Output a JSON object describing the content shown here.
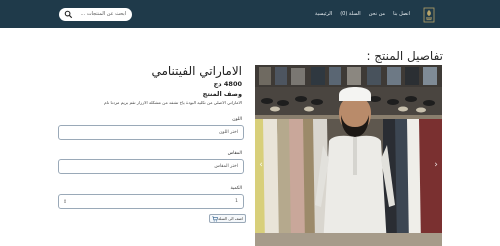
{
  "nav": {
    "search_placeholder": "ابحث عن المنتجات ...",
    "links": [
      "الرئيسية",
      "السلة (0)",
      "من نحن",
      "اتصل بنا"
    ]
  },
  "page": {
    "title": "تفاصيل المنتج :"
  },
  "product": {
    "name": "الاماراتي الفيتنامي",
    "price": "4800 دج",
    "description_title": "وصف المنتج",
    "description": "الاماراتي الاصلي من تكليه البودة ياخ تشفد من مشكلة الازرار تقم بريم مردنا نام",
    "image_alt": "product-photo"
  },
  "form": {
    "color_label": "اللون",
    "color_value": "اختر اللون",
    "size_label": "المقاس",
    "size_value": "اختر المقاس",
    "quantity_label": "الكمية",
    "quantity_value": "1",
    "add_to_cart": "اضف الى السلة"
  },
  "colors": {
    "navbar": "#1f3a4a",
    "border": "#9aa9b8"
  }
}
